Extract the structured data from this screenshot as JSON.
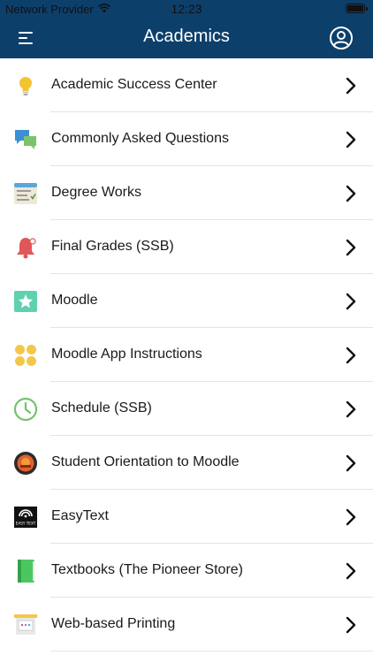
{
  "status_bar": {
    "carrier": "Network Provider",
    "time": "12:23"
  },
  "header": {
    "title": "Academics",
    "menu_icon": "hamburger-menu-icon",
    "profile_icon": "user-account-icon",
    "background_color": "#0d3f6b"
  },
  "items": [
    {
      "label": "Academic Success Center",
      "icon": "lightbulb-icon"
    },
    {
      "label": "Commonly Asked Questions",
      "icon": "chat-bubbles-icon"
    },
    {
      "label": "Degree Works",
      "icon": "checklist-icon"
    },
    {
      "label": "Final Grades (SSB)",
      "icon": "bell-icon"
    },
    {
      "label": "Moodle",
      "icon": "star-icon"
    },
    {
      "label": "Moodle App Instructions",
      "icon": "four-dots-icon"
    },
    {
      "label": "Schedule (SSB)",
      "icon": "clock-icon"
    },
    {
      "label": "Student Orientation to Moodle",
      "icon": "orientation-badge-icon"
    },
    {
      "label": "EasyText",
      "icon": "easytext-logo-icon",
      "icon_text": "EASY TEXT"
    },
    {
      "label": "Textbooks (The Pioneer Store)",
      "icon": "book-icon"
    },
    {
      "label": "Web-based Printing",
      "icon": "printer-icon"
    }
  ]
}
